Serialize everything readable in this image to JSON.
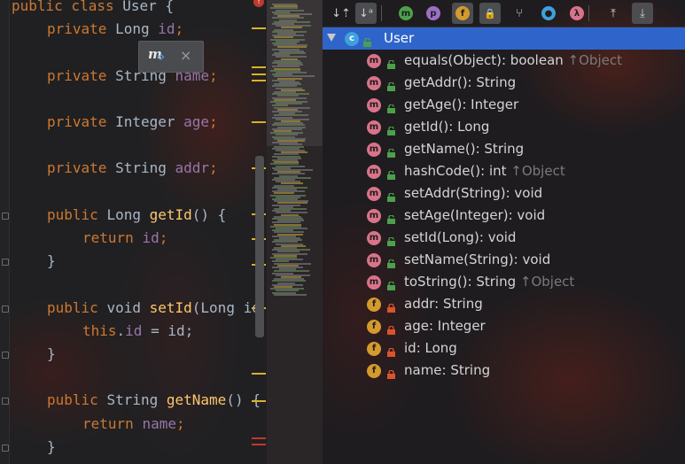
{
  "editor": {
    "lines": [
      {
        "kind": "class",
        "kw": "public class ",
        "name": "User",
        "rest": " {"
      },
      {
        "kind": "field",
        "kw": "private ",
        "type": "Long ",
        "name": "id",
        "rest": ";"
      },
      {
        "kind": "blank"
      },
      {
        "kind": "field",
        "kw": "private ",
        "type": "String ",
        "name": "name",
        "rest": ";"
      },
      {
        "kind": "blank"
      },
      {
        "kind": "field",
        "kw": "private ",
        "type": "Integer ",
        "name": "age",
        "rest": ";"
      },
      {
        "kind": "blank"
      },
      {
        "kind": "field",
        "kw": "private ",
        "type": "String ",
        "name": "addr",
        "rest": ";"
      },
      {
        "kind": "blank"
      },
      {
        "kind": "method",
        "kw": "public ",
        "type": "Long ",
        "name": "getId",
        "rest": "() {"
      },
      {
        "kind": "body",
        "kw": "return ",
        "val": "id",
        "rest": ";"
      },
      {
        "kind": "close",
        "rest": "}"
      },
      {
        "kind": "blank"
      },
      {
        "kind": "method",
        "kw": "public ",
        "type": "void ",
        "name": "setId",
        "rest": "(Long id"
      },
      {
        "kind": "this",
        "kw": "this",
        "dot": ".",
        "fld": "id",
        "rest": " = id;"
      },
      {
        "kind": "close",
        "rest": "}"
      },
      {
        "kind": "blank"
      },
      {
        "kind": "method",
        "kw": "public ",
        "type": "String ",
        "name": "getName",
        "rest": "() {"
      },
      {
        "kind": "body",
        "kw": "return ",
        "val": "name",
        "rest": ";"
      },
      {
        "kind": "close",
        "rest": "}"
      }
    ],
    "popup": {
      "icon": "method-icon",
      "close": "×"
    }
  },
  "structure": {
    "toolbar": [
      {
        "name": "sort-by-visibility-icon",
        "glyph": "↓⇡",
        "on": false
      },
      {
        "name": "sort-alphabetically-icon",
        "glyph": "↓ᵃ",
        "on": true
      },
      {
        "name": "show-inherited-icon",
        "glyph": "m",
        "on": false,
        "color": "#4ca04c"
      },
      {
        "name": "show-properties-icon",
        "glyph": "p",
        "on": false,
        "color": "#9b6fc4"
      },
      {
        "name": "show-fields-icon",
        "glyph": "f",
        "on": true,
        "color": "#d49a2e"
      },
      {
        "name": "show-non-public-icon",
        "glyph": "🔒",
        "on": true
      },
      {
        "name": "show-hierarchy-icon",
        "glyph": "⑂",
        "on": false
      },
      {
        "name": "anonymous-classes-icon",
        "glyph": "●",
        "on": false,
        "color": "#3fa0dd"
      },
      {
        "name": "show-lambdas-icon",
        "glyph": "λ",
        "on": false,
        "color": "#d9738a"
      },
      {
        "name": "expand-all-icon",
        "glyph": "⤒",
        "on": false
      },
      {
        "name": "collapse-all-icon",
        "glyph": "⤓",
        "on": true
      }
    ],
    "root": {
      "label": "User",
      "icon": "c"
    },
    "members": [
      {
        "type": "m",
        "vis": "public",
        "label": "equals(Object): boolean",
        "inherited": "↑Object"
      },
      {
        "type": "m",
        "vis": "public",
        "label": "getAddr(): String",
        "inherited": ""
      },
      {
        "type": "m",
        "vis": "public",
        "label": "getAge(): Integer",
        "inherited": ""
      },
      {
        "type": "m",
        "vis": "public",
        "label": "getId(): Long",
        "inherited": ""
      },
      {
        "type": "m",
        "vis": "public",
        "label": "getName(): String",
        "inherited": ""
      },
      {
        "type": "m",
        "vis": "public",
        "label": "hashCode(): int",
        "inherited": "↑Object"
      },
      {
        "type": "m",
        "vis": "public",
        "label": "setAddr(String): void",
        "inherited": ""
      },
      {
        "type": "m",
        "vis": "public",
        "label": "setAge(Integer): void",
        "inherited": ""
      },
      {
        "type": "m",
        "vis": "public",
        "label": "setId(Long): void",
        "inherited": ""
      },
      {
        "type": "m",
        "vis": "public",
        "label": "setName(String): void",
        "inherited": ""
      },
      {
        "type": "m",
        "vis": "public",
        "label": "toString(): String",
        "inherited": "↑Object"
      },
      {
        "type": "f",
        "vis": "private",
        "label": "addr: String",
        "inherited": ""
      },
      {
        "type": "f",
        "vis": "private",
        "label": "age: Integer",
        "inherited": ""
      },
      {
        "type": "f",
        "vis": "private",
        "label": "id: Long",
        "inherited": ""
      },
      {
        "type": "f",
        "vis": "private",
        "label": "name: String",
        "inherited": ""
      }
    ],
    "colors": {
      "method": "#d9738a",
      "field": "#d49a2e",
      "class": "#3fa0dd",
      "selection": "#2f65ca",
      "public": "#4ca04c",
      "private": "#d9542a"
    }
  }
}
